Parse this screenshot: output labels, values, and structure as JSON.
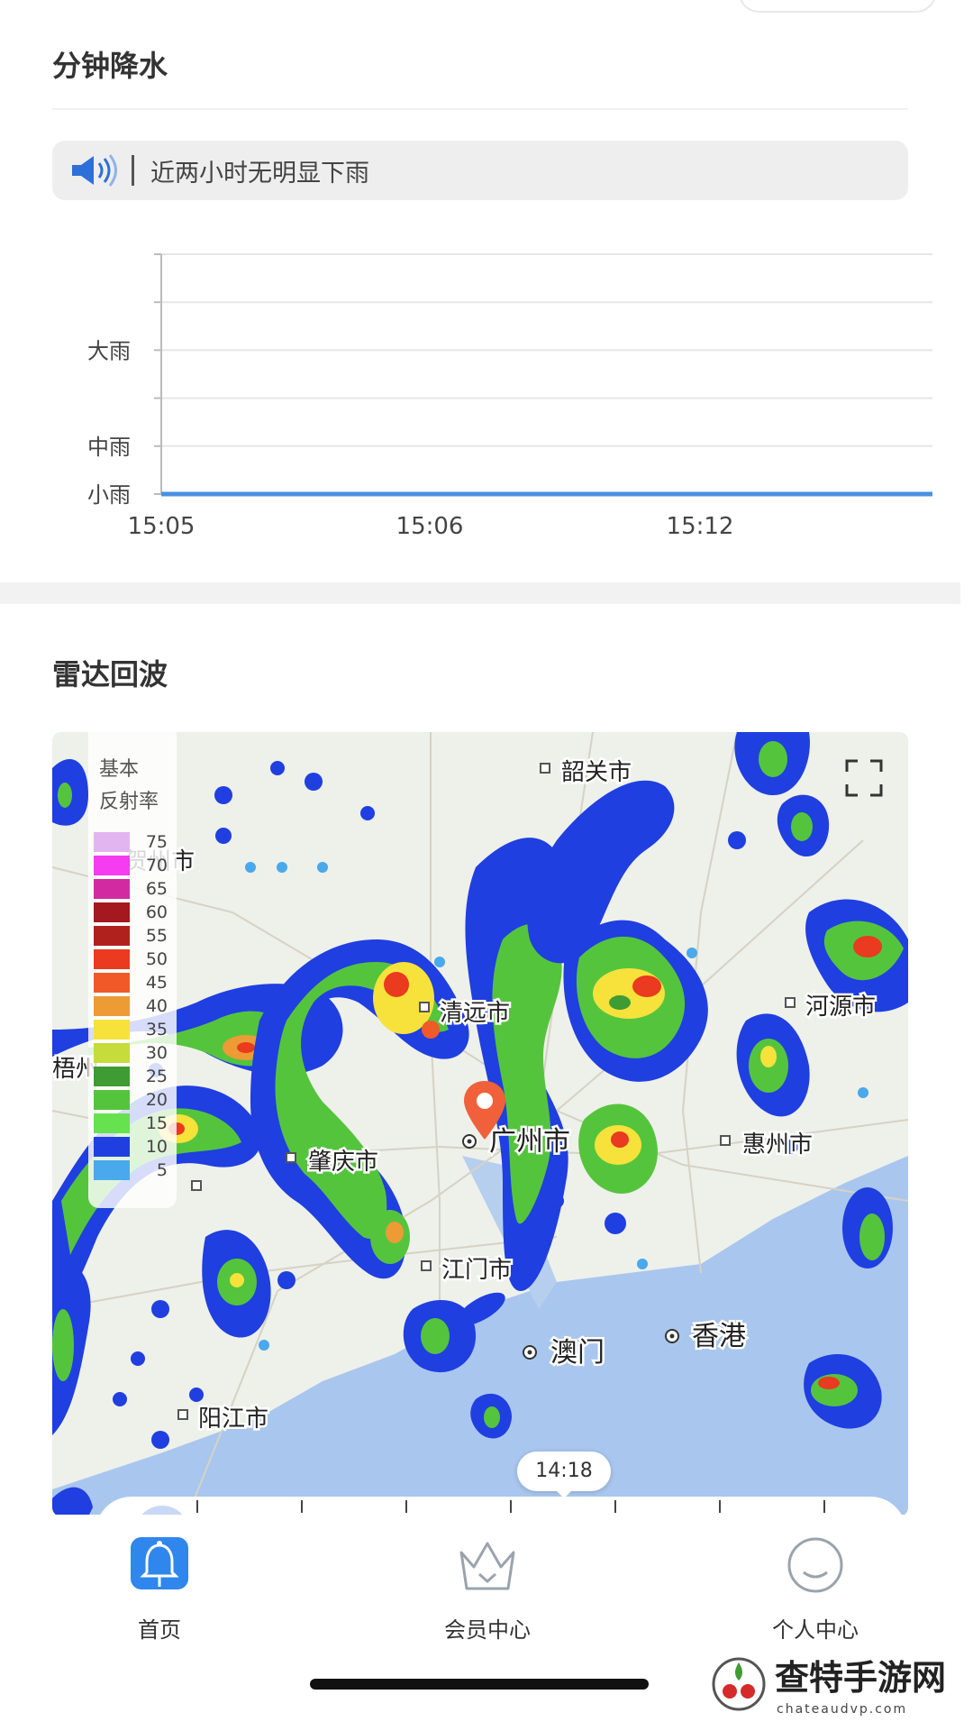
{
  "precip": {
    "title": "分钟降水",
    "notice": "近两小时无明显下雨"
  },
  "chart_data": {
    "type": "line",
    "title": "",
    "xlabel": "",
    "ylabel": "",
    "x": [
      "15:05",
      "15:06",
      "15:12"
    ],
    "y_tick_labels": [
      "大雨",
      "中雨",
      "小雨"
    ],
    "series": [
      {
        "name": "",
        "values": [
          0,
          0,
          0
        ]
      }
    ],
    "grid": true,
    "line_color": "#4a90e2"
  },
  "radar": {
    "title": "雷达回波",
    "legend_title": [
      "基本",
      "反射率"
    ],
    "legend": [
      {
        "value": "75",
        "color": "#e3b5f0"
      },
      {
        "value": "70",
        "color": "#f53cf0"
      },
      {
        "value": "65",
        "color": "#d22aa0"
      },
      {
        "value": "60",
        "color": "#a3191f"
      },
      {
        "value": "55",
        "color": "#b0211d"
      },
      {
        "value": "50",
        "color": "#ea3a1f"
      },
      {
        "value": "45",
        "color": "#f05a28"
      },
      {
        "value": "40",
        "color": "#ec9b35"
      },
      {
        "value": "35",
        "color": "#f6e23b"
      },
      {
        "value": "30",
        "color": "#c5dc3a"
      },
      {
        "value": "25",
        "color": "#3f9b34"
      },
      {
        "value": "20",
        "color": "#55c43d"
      },
      {
        "value": "15",
        "color": "#66e24f"
      },
      {
        "value": "10",
        "color": "#1f3fe0"
      },
      {
        "value": "5",
        "color": "#4aa8ec"
      }
    ],
    "cities": {
      "shaoguan": "韶关市",
      "qingyuan": "清远市",
      "heyuan": "河源市",
      "guangzhou": "广州市",
      "huizhou": "惠州市",
      "zhaoqing": "肇庆市",
      "jiangmen": "江门市",
      "macau": "澳门",
      "hongkong": "香港",
      "yangjiang": "阳江市",
      "wuzhou": "梧州",
      "hezhou": "贺州市"
    },
    "time": "14:18"
  },
  "tabbar": {
    "home": "首页",
    "member": "会员中心",
    "personal": "个人中心"
  },
  "watermark": {
    "name": "查特手游网",
    "url": "chateaudvp.com"
  }
}
